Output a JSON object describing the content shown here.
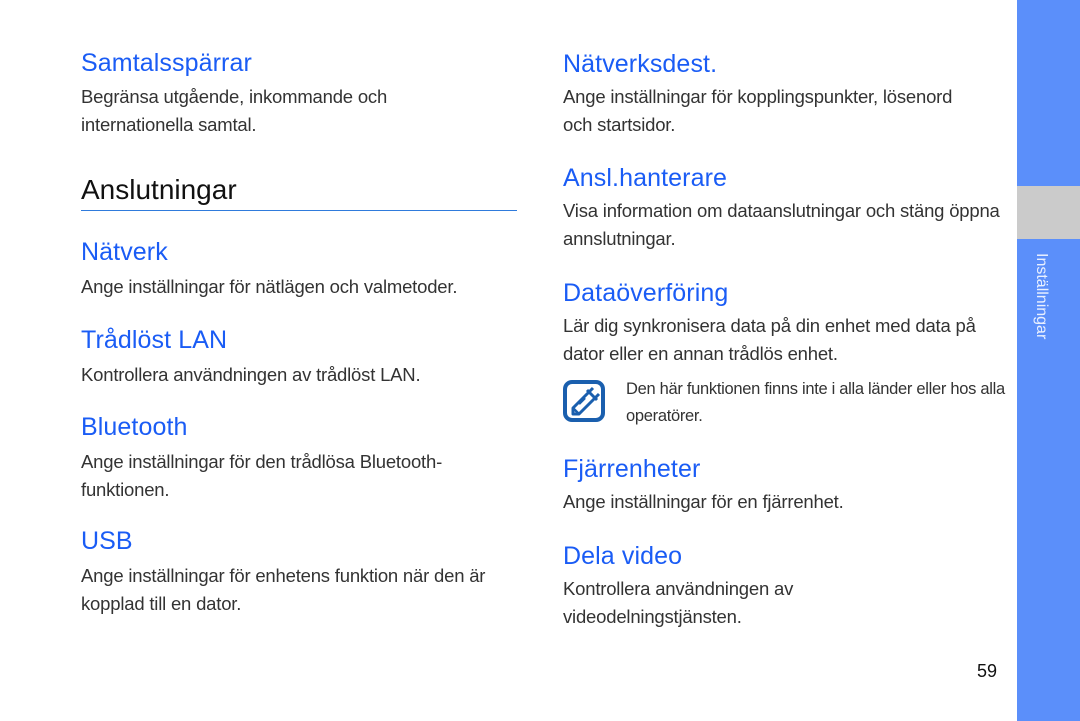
{
  "page": {
    "number": "59",
    "sidebar_label": "Inställningar"
  },
  "left": {
    "top_item": {
      "title": "Samtalsspärrar",
      "desc": "Begränsa utgående, inkommande och internationella samtal."
    },
    "section_title": "Anslutningar",
    "items": [
      {
        "title": "Nätverk",
        "desc": "Ange inställningar för nätlägen och valmetoder."
      },
      {
        "title": "Trådlöst LAN",
        "desc": "Kontrollera användningen av trådlöst LAN."
      },
      {
        "title": "Bluetooth",
        "desc": "Ange inställningar för den trådlösa Bluetooth-funktionen."
      },
      {
        "title": "USB",
        "desc": "Ange inställningar för enhetens funktion när den är kopplad till en dator."
      }
    ]
  },
  "right": {
    "items": [
      {
        "title": "Nätverksdest.",
        "desc": "Ange inställningar för kopplingspunkter, lösenord och startsidor."
      },
      {
        "title": "Ansl.hanterare",
        "desc": "Visa information om dataanslutningar och stäng öppna annslutningar."
      },
      {
        "title": "Dataöverföring",
        "desc": "Lär dig synkronisera data på din enhet med data på dator eller en annan trådlös enhet."
      },
      {
        "title": "Fjärrenheter",
        "desc": "Ange inställningar för en fjärrenhet."
      },
      {
        "title": "Dela video",
        "desc": "Kontrollera användningen av videodelningstjänsten."
      }
    ],
    "note": {
      "icon": "note-pencil-icon",
      "text": "Den här funktionen finns inte i alla länder eller hos alla operatörer."
    }
  },
  "colors": {
    "heading": "#1a5cf5",
    "sidebar": "#5b8ffa",
    "sidebar_block": "#cbcbcb",
    "rule": "#2f7bdc",
    "note_icon": "#1a5fae"
  }
}
